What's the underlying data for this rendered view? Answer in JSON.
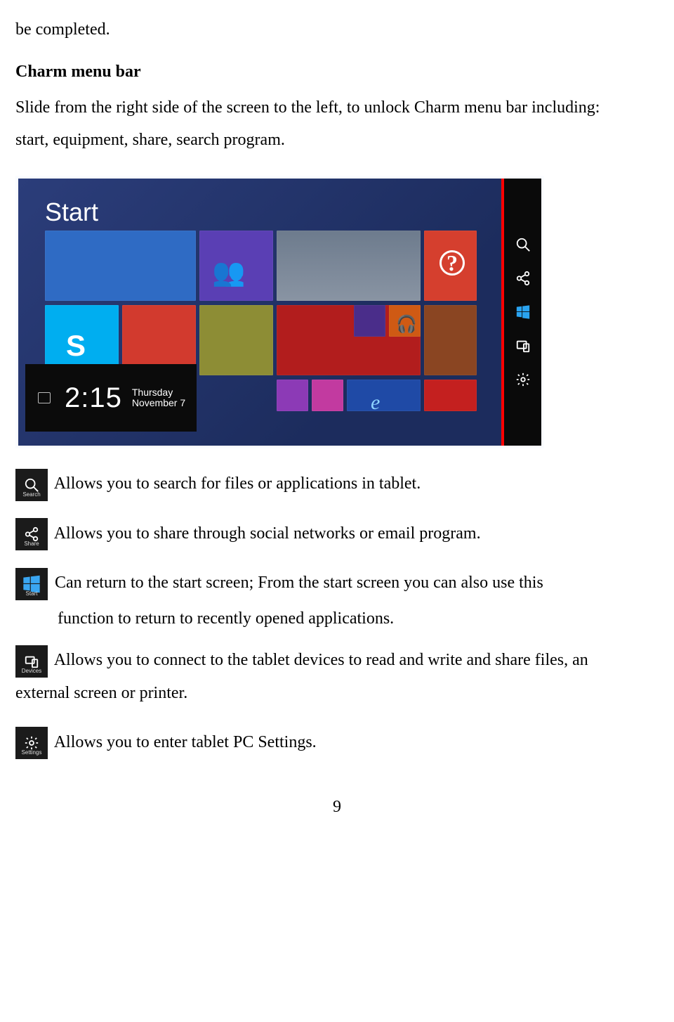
{
  "intro": {
    "continuation": "be completed.",
    "heading": "Charm menu bar",
    "p1": "Slide from the right side of the screen to the left, to unlock Charm menu bar including:",
    "p2": "start, equipment, share, search program."
  },
  "screenshot": {
    "start_label": "Start",
    "clock": {
      "time": "2:15",
      "weekday": "Thursday",
      "date": "November 7"
    }
  },
  "items": {
    "search": {
      "caption": "Search",
      "text": "Allows you to search for files or applications in tablet."
    },
    "share": {
      "caption": "Share",
      "text": "Allows you to share through social networks or email program."
    },
    "start": {
      "caption": "Start",
      "text_line1": "Can return to the start screen; From the start screen you can also use this",
      "text_line2": "function to return to recently opened applications."
    },
    "devices": {
      "caption": "Devices",
      "text_line1": "Allows you to connect to the tablet devices to read and write and share files, an",
      "text_line2": "external screen or printer."
    },
    "settings": {
      "caption": "Settings",
      "text": "Allows you to enter tablet PC Settings."
    }
  },
  "page_number": "9"
}
